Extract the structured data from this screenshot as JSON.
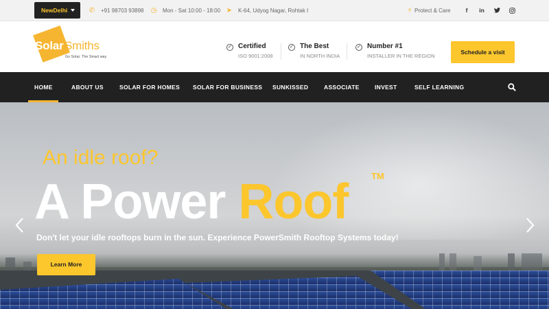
{
  "topbar": {
    "city": "NewDelhi",
    "phone": "+91 98703 93898",
    "hours": "Mon - Sat 10:00 - 18:00",
    "address": "K-64, Udyog Nagar, Rohtak I",
    "protect_link": "Protect & Care",
    "social": [
      {
        "icon": "facebook-icon",
        "glyph": "f"
      },
      {
        "icon": "linkedin-icon",
        "glyph": "in"
      },
      {
        "icon": "twitter-icon",
        "glyph": "t"
      },
      {
        "icon": "instagram-icon",
        "glyph": "◎"
      }
    ]
  },
  "header": {
    "logo_solar": "Solar",
    "logo_smiths": "Smiths",
    "logo_tagline": "Go Solar, The Smart way",
    "features": [
      {
        "title": "Certified",
        "subtitle": "ISO 9001:2008"
      },
      {
        "title": "The Best",
        "subtitle": "IN NORTH INDIA"
      },
      {
        "title": "Number #1",
        "subtitle": "INSTALLER IN THE REGION"
      }
    ],
    "cta_label": "Schedule a visit"
  },
  "nav": {
    "items": [
      "HOME",
      "ABOUT US",
      "SOLAR FOR HOMES",
      "SOLAR FOR BUSINESS",
      "SUNKISSED",
      "ASSOCIATE",
      "INVEST",
      "SELF LEARNING"
    ],
    "active_index": 0
  },
  "hero": {
    "question": "An idle roof?",
    "headline_white": "A Power",
    "headline_yellow": "Roof",
    "trademark": "TM",
    "subtitle": "Don't let your idle rooftops burn in the sun. Experience PowerSmith Rooftop Systems today!",
    "button_label": "Learn More"
  },
  "colors": {
    "accent": "#fcc62d",
    "dark": "#212121",
    "topbar_bg": "#f2f2f2"
  }
}
